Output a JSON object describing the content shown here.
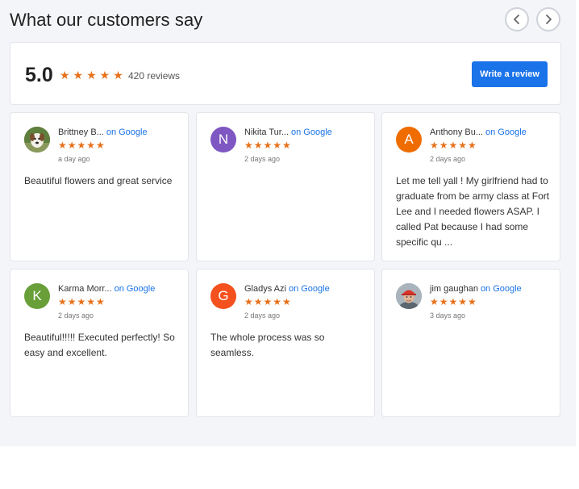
{
  "widget": {
    "title": "What our customers say",
    "nav": {
      "prev_icon": "chevron-left-icon",
      "next_icon": "chevron-right-icon"
    }
  },
  "summary": {
    "score": "5.0",
    "stars": "★★★★★",
    "rating": 5,
    "review_count": "420 reviews",
    "write_review_label": "Write a review"
  },
  "colors": {
    "accent": "#1a73e8",
    "star": "#e7711b",
    "background": "#f4f5f9"
  },
  "reviews": [
    {
      "name": "Brittney B...",
      "on": "on",
      "source": "Google",
      "stars": "★★★★★",
      "rating": 5,
      "date": "a day ago",
      "text": "Beautiful flowers and great service",
      "avatar": {
        "type": "photo",
        "subject": "dog"
      }
    },
    {
      "name": "Nikita Tur...",
      "on": "on",
      "source": "Google",
      "stars": "★★★★★",
      "rating": 5,
      "date": "2 days ago",
      "text": "",
      "avatar": {
        "type": "letter",
        "letter": "N",
        "color": "#7e57c2"
      }
    },
    {
      "name": "Anthony Bu...",
      "on": "on",
      "source": "Google",
      "stars": "★★★★★",
      "rating": 5,
      "date": "2 days ago",
      "text": "Let me tell yall ! My girlfriend had to graduate from be army class at Fort Lee and I needed flowers ASAP. I called Pat because I had some specific qu ...",
      "avatar": {
        "type": "letter",
        "letter": "A",
        "color": "#ef6c00"
      }
    },
    {
      "name": "Karma Morr...",
      "on": "on",
      "source": "Google",
      "stars": "★★★★★",
      "rating": 5,
      "date": "2 days ago",
      "text": "Beautiful!!!!! Executed perfectly! So easy and excellent.",
      "avatar": {
        "type": "letter",
        "letter": "K",
        "color": "#689f38"
      }
    },
    {
      "name": "Gladys Azi",
      "on": "on",
      "source": "Google",
      "stars": "★★★★★",
      "rating": 5,
      "date": "2 days ago",
      "text": "The whole process was so seamless.",
      "avatar": {
        "type": "letter",
        "letter": "G",
        "color": "#f4511e"
      }
    },
    {
      "name": "jim gaughan",
      "on": "on",
      "source": "Google",
      "stars": "★★★★★",
      "rating": 5,
      "date": "3 days ago",
      "text": "",
      "avatar": {
        "type": "photo",
        "subject": "man with red cap"
      }
    }
  ]
}
